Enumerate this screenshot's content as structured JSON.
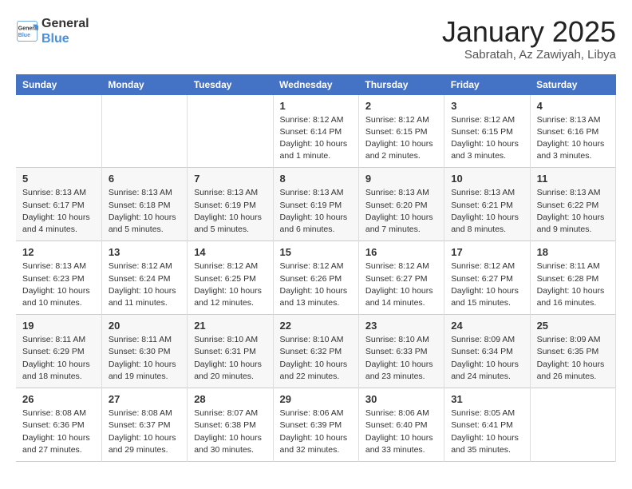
{
  "header": {
    "logo_line1": "General",
    "logo_line2": "Blue",
    "title": "January 2025",
    "subtitle": "Sabratah, Az Zawiyah, Libya"
  },
  "weekdays": [
    "Sunday",
    "Monday",
    "Tuesday",
    "Wednesday",
    "Thursday",
    "Friday",
    "Saturday"
  ],
  "weeks": [
    [
      {
        "day": "",
        "info": ""
      },
      {
        "day": "",
        "info": ""
      },
      {
        "day": "",
        "info": ""
      },
      {
        "day": "1",
        "info": "Sunrise: 8:12 AM\nSunset: 6:14 PM\nDaylight: 10 hours\nand 1 minute."
      },
      {
        "day": "2",
        "info": "Sunrise: 8:12 AM\nSunset: 6:15 PM\nDaylight: 10 hours\nand 2 minutes."
      },
      {
        "day": "3",
        "info": "Sunrise: 8:12 AM\nSunset: 6:15 PM\nDaylight: 10 hours\nand 3 minutes."
      },
      {
        "day": "4",
        "info": "Sunrise: 8:13 AM\nSunset: 6:16 PM\nDaylight: 10 hours\nand 3 minutes."
      }
    ],
    [
      {
        "day": "5",
        "info": "Sunrise: 8:13 AM\nSunset: 6:17 PM\nDaylight: 10 hours\nand 4 minutes."
      },
      {
        "day": "6",
        "info": "Sunrise: 8:13 AM\nSunset: 6:18 PM\nDaylight: 10 hours\nand 5 minutes."
      },
      {
        "day": "7",
        "info": "Sunrise: 8:13 AM\nSunset: 6:19 PM\nDaylight: 10 hours\nand 5 minutes."
      },
      {
        "day": "8",
        "info": "Sunrise: 8:13 AM\nSunset: 6:19 PM\nDaylight: 10 hours\nand 6 minutes."
      },
      {
        "day": "9",
        "info": "Sunrise: 8:13 AM\nSunset: 6:20 PM\nDaylight: 10 hours\nand 7 minutes."
      },
      {
        "day": "10",
        "info": "Sunrise: 8:13 AM\nSunset: 6:21 PM\nDaylight: 10 hours\nand 8 minutes."
      },
      {
        "day": "11",
        "info": "Sunrise: 8:13 AM\nSunset: 6:22 PM\nDaylight: 10 hours\nand 9 minutes."
      }
    ],
    [
      {
        "day": "12",
        "info": "Sunrise: 8:13 AM\nSunset: 6:23 PM\nDaylight: 10 hours\nand 10 minutes."
      },
      {
        "day": "13",
        "info": "Sunrise: 8:12 AM\nSunset: 6:24 PM\nDaylight: 10 hours\nand 11 minutes."
      },
      {
        "day": "14",
        "info": "Sunrise: 8:12 AM\nSunset: 6:25 PM\nDaylight: 10 hours\nand 12 minutes."
      },
      {
        "day": "15",
        "info": "Sunrise: 8:12 AM\nSunset: 6:26 PM\nDaylight: 10 hours\nand 13 minutes."
      },
      {
        "day": "16",
        "info": "Sunrise: 8:12 AM\nSunset: 6:27 PM\nDaylight: 10 hours\nand 14 minutes."
      },
      {
        "day": "17",
        "info": "Sunrise: 8:12 AM\nSunset: 6:27 PM\nDaylight: 10 hours\nand 15 minutes."
      },
      {
        "day": "18",
        "info": "Sunrise: 8:11 AM\nSunset: 6:28 PM\nDaylight: 10 hours\nand 16 minutes."
      }
    ],
    [
      {
        "day": "19",
        "info": "Sunrise: 8:11 AM\nSunset: 6:29 PM\nDaylight: 10 hours\nand 18 minutes."
      },
      {
        "day": "20",
        "info": "Sunrise: 8:11 AM\nSunset: 6:30 PM\nDaylight: 10 hours\nand 19 minutes."
      },
      {
        "day": "21",
        "info": "Sunrise: 8:10 AM\nSunset: 6:31 PM\nDaylight: 10 hours\nand 20 minutes."
      },
      {
        "day": "22",
        "info": "Sunrise: 8:10 AM\nSunset: 6:32 PM\nDaylight: 10 hours\nand 22 minutes."
      },
      {
        "day": "23",
        "info": "Sunrise: 8:10 AM\nSunset: 6:33 PM\nDaylight: 10 hours\nand 23 minutes."
      },
      {
        "day": "24",
        "info": "Sunrise: 8:09 AM\nSunset: 6:34 PM\nDaylight: 10 hours\nand 24 minutes."
      },
      {
        "day": "25",
        "info": "Sunrise: 8:09 AM\nSunset: 6:35 PM\nDaylight: 10 hours\nand 26 minutes."
      }
    ],
    [
      {
        "day": "26",
        "info": "Sunrise: 8:08 AM\nSunset: 6:36 PM\nDaylight: 10 hours\nand 27 minutes."
      },
      {
        "day": "27",
        "info": "Sunrise: 8:08 AM\nSunset: 6:37 PM\nDaylight: 10 hours\nand 29 minutes."
      },
      {
        "day": "28",
        "info": "Sunrise: 8:07 AM\nSunset: 6:38 PM\nDaylight: 10 hours\nand 30 minutes."
      },
      {
        "day": "29",
        "info": "Sunrise: 8:06 AM\nSunset: 6:39 PM\nDaylight: 10 hours\nand 32 minutes."
      },
      {
        "day": "30",
        "info": "Sunrise: 8:06 AM\nSunset: 6:40 PM\nDaylight: 10 hours\nand 33 minutes."
      },
      {
        "day": "31",
        "info": "Sunrise: 8:05 AM\nSunset: 6:41 PM\nDaylight: 10 hours\nand 35 minutes."
      },
      {
        "day": "",
        "info": ""
      }
    ]
  ]
}
